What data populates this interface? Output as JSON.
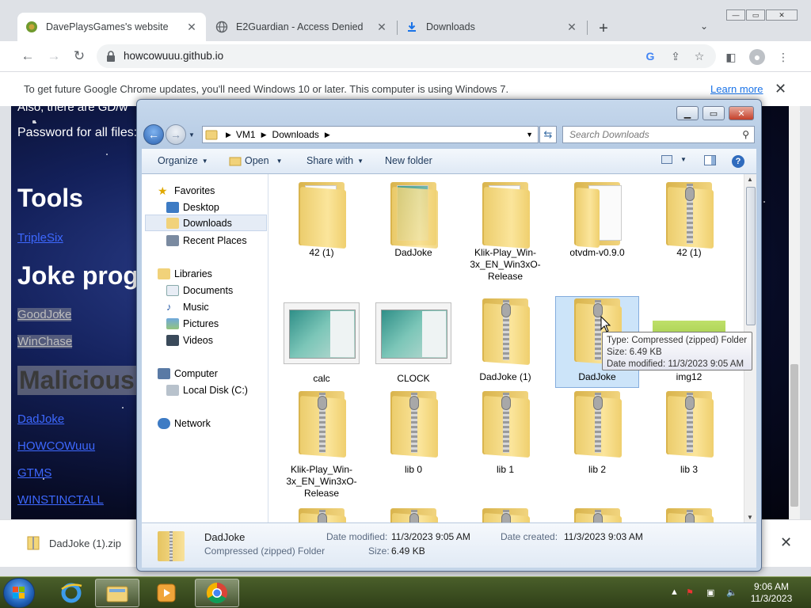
{
  "browser": {
    "tabs": [
      {
        "title": "DavePlaysGames's website",
        "active": true
      },
      {
        "title": "E2Guardian - Access Denied",
        "active": false
      },
      {
        "title": "Downloads",
        "active": false
      }
    ],
    "url": "howcowuuu.github.io",
    "infobar": {
      "text": "To get future Google Chrome updates, you'll need Windows 10 or later. This computer is using Windows 7.",
      "link": "Learn more"
    },
    "download": {
      "filename": "DadJoke (1).zip"
    }
  },
  "page": {
    "partial_line1": "Also, there are GD/w",
    "password_line": "Password for all files:",
    "tools_heading": "Tools",
    "tools_links": [
      "TripleSix"
    ],
    "joke_heading": "Joke prog",
    "joke_links": [
      "GoodJoke",
      "WinChase"
    ],
    "malicious_heading": "Malicious",
    "malicious_links": [
      "DadJoke",
      "HOWCOWuuu",
      "GTMS",
      "WINSTINCTALL"
    ]
  },
  "explorer": {
    "breadcrumb": [
      "VM1",
      "Downloads"
    ],
    "search_placeholder": "Search Downloads",
    "commands": {
      "organize": "Organize",
      "open": "Open",
      "share": "Share with",
      "new_folder": "New folder"
    },
    "nav": {
      "favorites": "Favorites",
      "desktop": "Desktop",
      "downloads": "Downloads",
      "recent": "Recent Places",
      "libraries": "Libraries",
      "documents": "Documents",
      "music": "Music",
      "pictures": "Pictures",
      "videos": "Videos",
      "computer": "Computer",
      "local_disk": "Local Disk (C:)",
      "network": "Network"
    },
    "files": [
      {
        "name": "42 (1)",
        "kind": "folder"
      },
      {
        "name": "DadJoke",
        "kind": "folder-doc"
      },
      {
        "name": "Klik-Play_Win-3x_EN_Win3xO-Release",
        "kind": "folder"
      },
      {
        "name": "otvdm-v0.9.0",
        "kind": "folder-open"
      },
      {
        "name": "42 (1)",
        "kind": "zip"
      },
      {
        "name": "calc",
        "kind": "thumb"
      },
      {
        "name": "CLOCK",
        "kind": "thumb"
      },
      {
        "name": "DadJoke (1)",
        "kind": "zip"
      },
      {
        "name": "DadJoke",
        "kind": "zip"
      },
      {
        "name": "img12",
        "kind": "image"
      },
      {
        "name": "Klik-Play_Win-3x_EN_Win3xO-Release",
        "kind": "zip"
      },
      {
        "name": "lib 0",
        "kind": "zip"
      },
      {
        "name": "lib 1",
        "kind": "zip"
      },
      {
        "name": "lib 2",
        "kind": "zip"
      },
      {
        "name": "lib 3",
        "kind": "zip"
      }
    ],
    "tooltip": {
      "type": "Type: Compressed (zipped) Folder",
      "size": "Size: 6.49 KB",
      "modified": "Date modified: 11/3/2023 9:05 AM"
    },
    "details": {
      "name": "DadJoke",
      "type": "Compressed (zipped) Folder",
      "modified_label": "Date modified:",
      "modified_value": "11/3/2023 9:05 AM",
      "created_label": "Date created:",
      "created_value": "11/3/2023 9:03 AM",
      "size_label": "Size:",
      "size_value": "6.49 KB"
    }
  },
  "taskbar": {
    "time": "9:06 AM",
    "date": "11/3/2023"
  }
}
